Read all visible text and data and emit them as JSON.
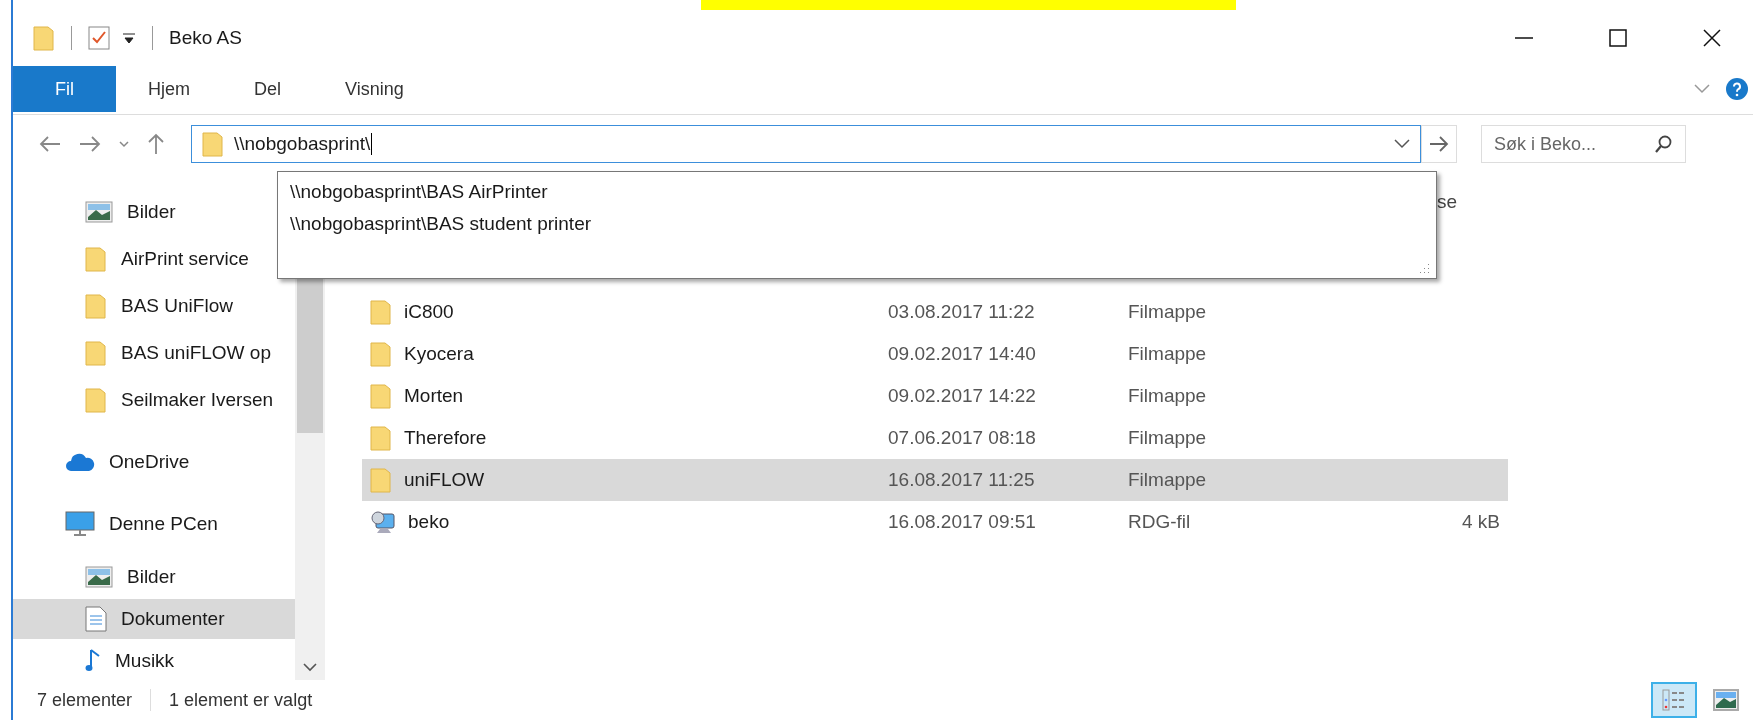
{
  "window": {
    "title": "Beko AS"
  },
  "ribbon_tabs": [
    {
      "label": "Fil",
      "kind": "file"
    },
    {
      "label": "Hjem",
      "kind": "tab"
    },
    {
      "label": "Del",
      "kind": "tab"
    },
    {
      "label": "Visning",
      "kind": "tab"
    }
  ],
  "address": {
    "value": "\\\\nobgobasprint\\"
  },
  "suggestions": [
    "\\\\nobgobasprint\\BAS AirPrinter",
    "\\\\nobgobasprint\\BAS student printer"
  ],
  "search": {
    "placeholder": "Søk i Beko..."
  },
  "sidebar": {
    "quick_items": [
      {
        "label": "Bilder",
        "kind": "picture",
        "selected": false
      },
      {
        "label": "AirPrint service",
        "kind": "folder",
        "selected": false
      },
      {
        "label": "BAS UniFlow",
        "kind": "folder",
        "selected": false
      },
      {
        "label": "BAS uniFLOW op",
        "kind": "folder",
        "selected": false
      },
      {
        "label": "Seilmaker Iversen",
        "kind": "folder",
        "selected": false
      }
    ],
    "items": [
      {
        "label": "OneDrive",
        "kind": "cloud",
        "selected": false
      },
      {
        "label": "Denne PCen",
        "kind": "pc",
        "selected": false,
        "children": [
          {
            "label": "Bilder",
            "kind": "picture",
            "selected": false
          },
          {
            "label": "Dokumenter",
            "kind": "document",
            "selected": true
          },
          {
            "label": "Musikk",
            "kind": "music",
            "selected": false
          }
        ]
      }
    ]
  },
  "table": {
    "column_4": "se",
    "rows": [
      {
        "name": "iC800",
        "date": "03.08.2017 11:22",
        "type": "Filmappe",
        "size": "",
        "kind": "folder",
        "selected": false
      },
      {
        "name": "Kyocera",
        "date": "09.02.2017 14:40",
        "type": "Filmappe",
        "size": "",
        "kind": "folder",
        "selected": false
      },
      {
        "name": "Morten",
        "date": "09.02.2017 14:22",
        "type": "Filmappe",
        "size": "",
        "kind": "folder",
        "selected": false
      },
      {
        "name": "Therefore",
        "date": "07.06.2017 08:18",
        "type": "Filmappe",
        "size": "",
        "kind": "folder",
        "selected": false
      },
      {
        "name": "uniFLOW",
        "date": "16.08.2017 11:25",
        "type": "Filmappe",
        "size": "",
        "kind": "folder",
        "selected": true
      },
      {
        "name": "beko",
        "date": "16.08.2017 09:51",
        "type": "RDG-fil",
        "size": "4 kB",
        "kind": "rdg",
        "selected": false
      }
    ]
  },
  "status_bar": {
    "count": "7 elementer",
    "selection": "1 element er valgt"
  },
  "view_buttons": [
    {
      "kind": "details",
      "selected": true
    },
    {
      "kind": "large-icons",
      "selected": false
    }
  ]
}
